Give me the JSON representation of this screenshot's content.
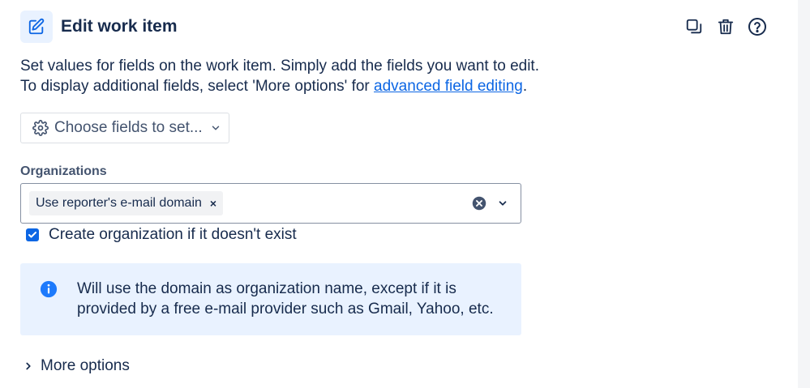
{
  "header": {
    "title": "Edit work item",
    "icons": {
      "edit": "pencil-square-icon",
      "copy": "copy-icon",
      "delete": "trash-icon",
      "help": "help-circle-icon"
    }
  },
  "description": {
    "line1": "Set values for fields on the work item. Simply add the fields you want to edit.",
    "line2_prefix": "To display additional fields, select 'More options' for ",
    "line2_link": "advanced field editing",
    "line2_suffix": "."
  },
  "choose_fields": {
    "label": "Choose fields to set...",
    "icon": "gear-icon"
  },
  "organizations": {
    "label": "Organizations",
    "selected_tag": "Use reporter's e-mail domain",
    "tag_remove": "×"
  },
  "create_org": {
    "checked": true,
    "label": "Create organization if it doesn't exist"
  },
  "info": {
    "line1": "Will use the domain as organization name, except if it is",
    "line2": "provided by a free e-mail provider such as Gmail, Yahoo, etc."
  },
  "more_options": {
    "label": "More options"
  },
  "colors": {
    "accent": "#0c66e4",
    "info_bg": "#e9f2ff",
    "text": "#172b4d"
  }
}
